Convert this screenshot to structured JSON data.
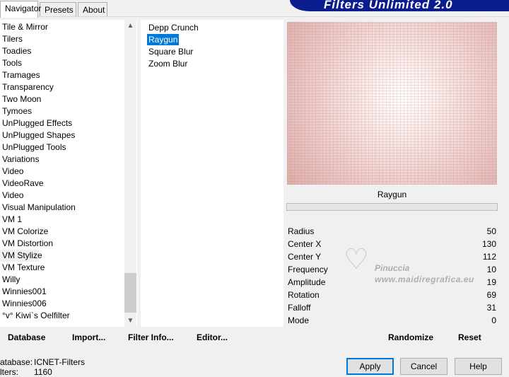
{
  "banner": {
    "title": "Filters Unlimited 2.0"
  },
  "tabs": [
    {
      "label": "Navigator",
      "active": true
    },
    {
      "label": "Presets",
      "active": false
    },
    {
      "label": "About",
      "active": false
    }
  ],
  "categories": [
    "Tile & Mirror",
    "Tilers",
    "Toadies",
    "Tools",
    "Tramages",
    "Transparency",
    "Two Moon",
    "Tymoes",
    "UnPlugged Effects",
    "UnPlugged Shapes",
    "UnPlugged Tools",
    "Variations",
    "Video",
    "VideoRave",
    "Video",
    "Visual Manipulation",
    "VM 1",
    "VM Colorize",
    "VM Distortion",
    "VM Stylize",
    "VM Texture",
    "Willy",
    "Winnies001",
    "Winnies006",
    "°v° Kiwi`s Oelfilter"
  ],
  "selected_category": "VM Stylize",
  "scroll": {
    "up_icon": "chevron-up-icon",
    "down_icon": "chevron-down-icon"
  },
  "filters": [
    "Depp Crunch",
    "Raygun",
    "Square Blur",
    "Zoom Blur"
  ],
  "selected_filter": "Raygun",
  "preview": {
    "caption": "Raygun"
  },
  "params": [
    {
      "name": "Radius",
      "value": "50"
    },
    {
      "name": "Center X",
      "value": "130"
    },
    {
      "name": "Center Y",
      "value": "112"
    },
    {
      "name": "Frequency",
      "value": "10"
    },
    {
      "name": "Amplitude",
      "value": "19"
    },
    {
      "name": "Rotation",
      "value": "69"
    },
    {
      "name": "Falloff",
      "value": "31"
    },
    {
      "name": "Mode",
      "value": "0"
    }
  ],
  "watermark": {
    "name": "Pinuccia",
    "site": "www.maidiregrafica.eu"
  },
  "toolbar": {
    "database": "Database",
    "import": "Import...",
    "filter_info": "Filter Info...",
    "editor": "Editor...",
    "randomize": "Randomize",
    "reset": "Reset"
  },
  "status": {
    "database_label": "atabase:",
    "database_value": "ICNET-Filters",
    "filters_label": "lters:",
    "filters_value": "1160"
  },
  "buttons": {
    "apply": "Apply",
    "cancel": "Cancel",
    "help": "Help"
  }
}
